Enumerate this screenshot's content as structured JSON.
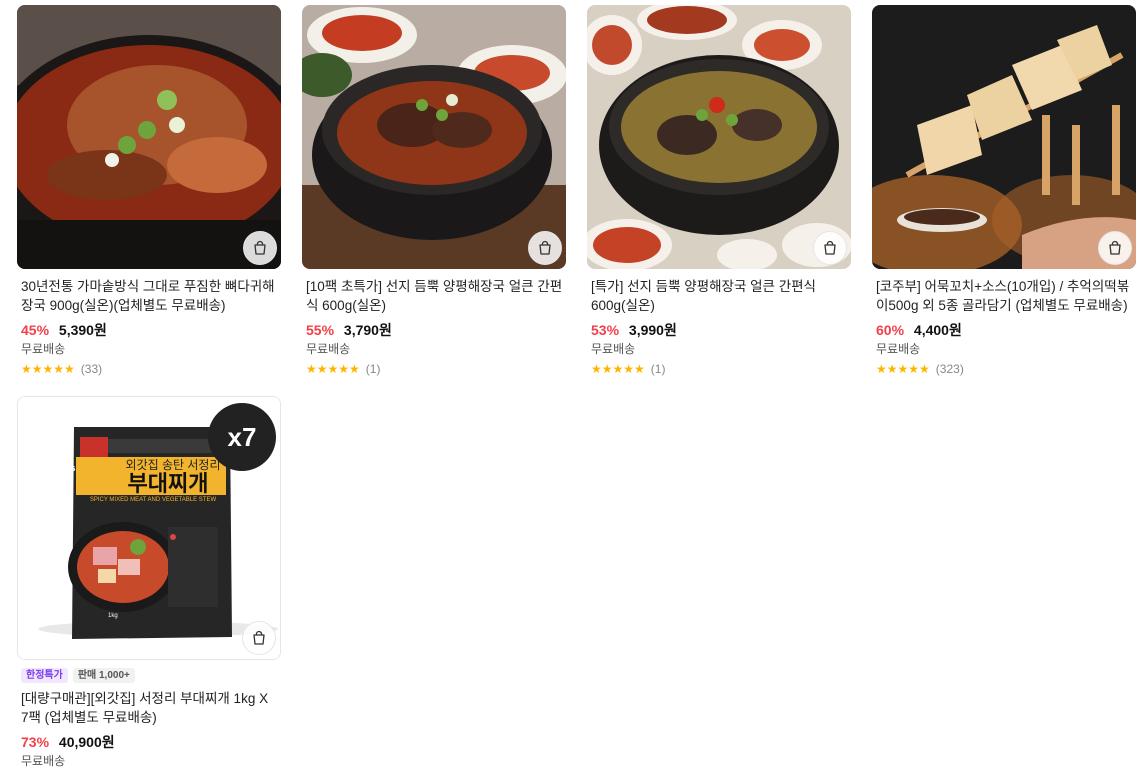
{
  "products": [
    {
      "title": "30년전통 가마솥방식 그대로 푸짐한 뼈다귀해장국 900g(실온)(업체별도 무료배송)",
      "discount": "45%",
      "price": "5,390원",
      "shipping": "무료배송",
      "stars": "★★★★★",
      "reviews": "(33)"
    },
    {
      "title": "[10팩 초특가] 선지 듬뿍 양평해장국 얼큰 간편식 600g(실온)",
      "discount": "55%",
      "price": "3,790원",
      "shipping": "무료배송",
      "stars": "★★★★★",
      "reviews": "(1)"
    },
    {
      "title": "[특가] 선지 듬뿍 양평해장국 얼큰 간편식 600g(실온)",
      "discount": "53%",
      "price": "3,990원",
      "shipping": "무료배송",
      "stars": "★★★★★",
      "reviews": "(1)"
    },
    {
      "title": "[코주부] 어묵꼬치+소스(10개입) / 추억의떡볶이500g 외 5종 골라담기 (업체별도 무료배송)",
      "discount": "60%",
      "price": "4,400원",
      "shipping": "무료배송",
      "stars": "★★★★★",
      "reviews": "(323)"
    },
    {
      "title": "[대량구매관][외갓집] 서정리 부대찌개 1kg X 7팩 (업체별도 무료배송)",
      "discount": "73%",
      "price": "40,900원",
      "shipping": "무료배송",
      "badge_limited": "한정특가",
      "badge_sold": "판매 1,000+",
      "qty_badge": "x7",
      "package_brand": "외갓집",
      "package_logo": "asian kitchen",
      "package_subtitle": "외갓집 송탄 서정리",
      "package_name": "부대찌개",
      "package_english": "SPICY MIXED MEAT AND VEGETABLE STEW",
      "package_weight": "1kg"
    }
  ],
  "icons": {
    "cart": "shopping-bag-icon",
    "star": "star-icon"
  },
  "colors": {
    "discount": "#f1404b",
    "star": "#ffb400",
    "limited_badge": "#7c3aed"
  }
}
